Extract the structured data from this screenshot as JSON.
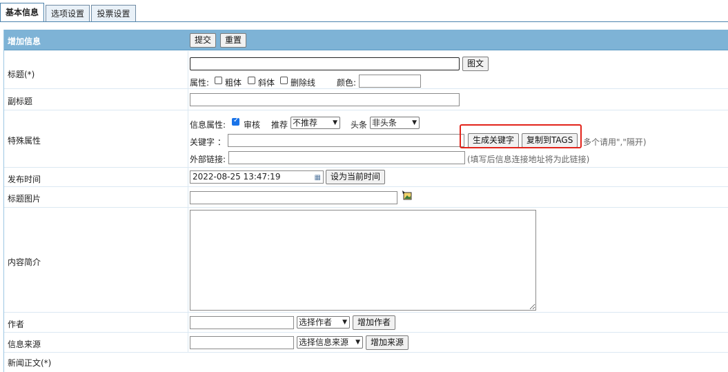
{
  "tabs": [
    "基本信息",
    "选项设置",
    "投票设置"
  ],
  "header": {
    "title": "增加信息",
    "submit": "提交",
    "reset": "重置"
  },
  "title_row": {
    "label": "标题(*)",
    "btn_image_text": "图文",
    "attr_label": "属性:",
    "bold": "粗体",
    "italic": "斜体",
    "strike": "删除线",
    "color_label": "颜色:"
  },
  "subtitle_row": {
    "label": "副标题"
  },
  "special_row": {
    "label": "特殊属性",
    "info_attr_label": "信息属性:",
    "review": "审核",
    "recommend_label": "推荐",
    "recommend_value": "不推荐",
    "headline_label": "头条",
    "headline_value": "非头条",
    "keyword_label": "关键字 ：",
    "gen_keyword_btn": "生成关键字",
    "copy_tags_btn": "复制到TAGS",
    "keyword_hint": "多个请用\",\"隔开)",
    "external_label": "外部链接:",
    "external_hint": "(填写后信息连接地址将为此链接)"
  },
  "publish_row": {
    "label": "发布时间",
    "value": "2022-08-25 13:47:19",
    "btn": "设为当前时间"
  },
  "image_row": {
    "label": "标题图片"
  },
  "summary_row": {
    "label": "内容简介"
  },
  "author_row": {
    "label": "作者",
    "select": "选择作者",
    "btn": "增加作者"
  },
  "source_row": {
    "label": "信息来源",
    "select": "选择信息来源",
    "btn": "增加来源"
  },
  "body_row": {
    "label": "新闻正文(*)"
  }
}
